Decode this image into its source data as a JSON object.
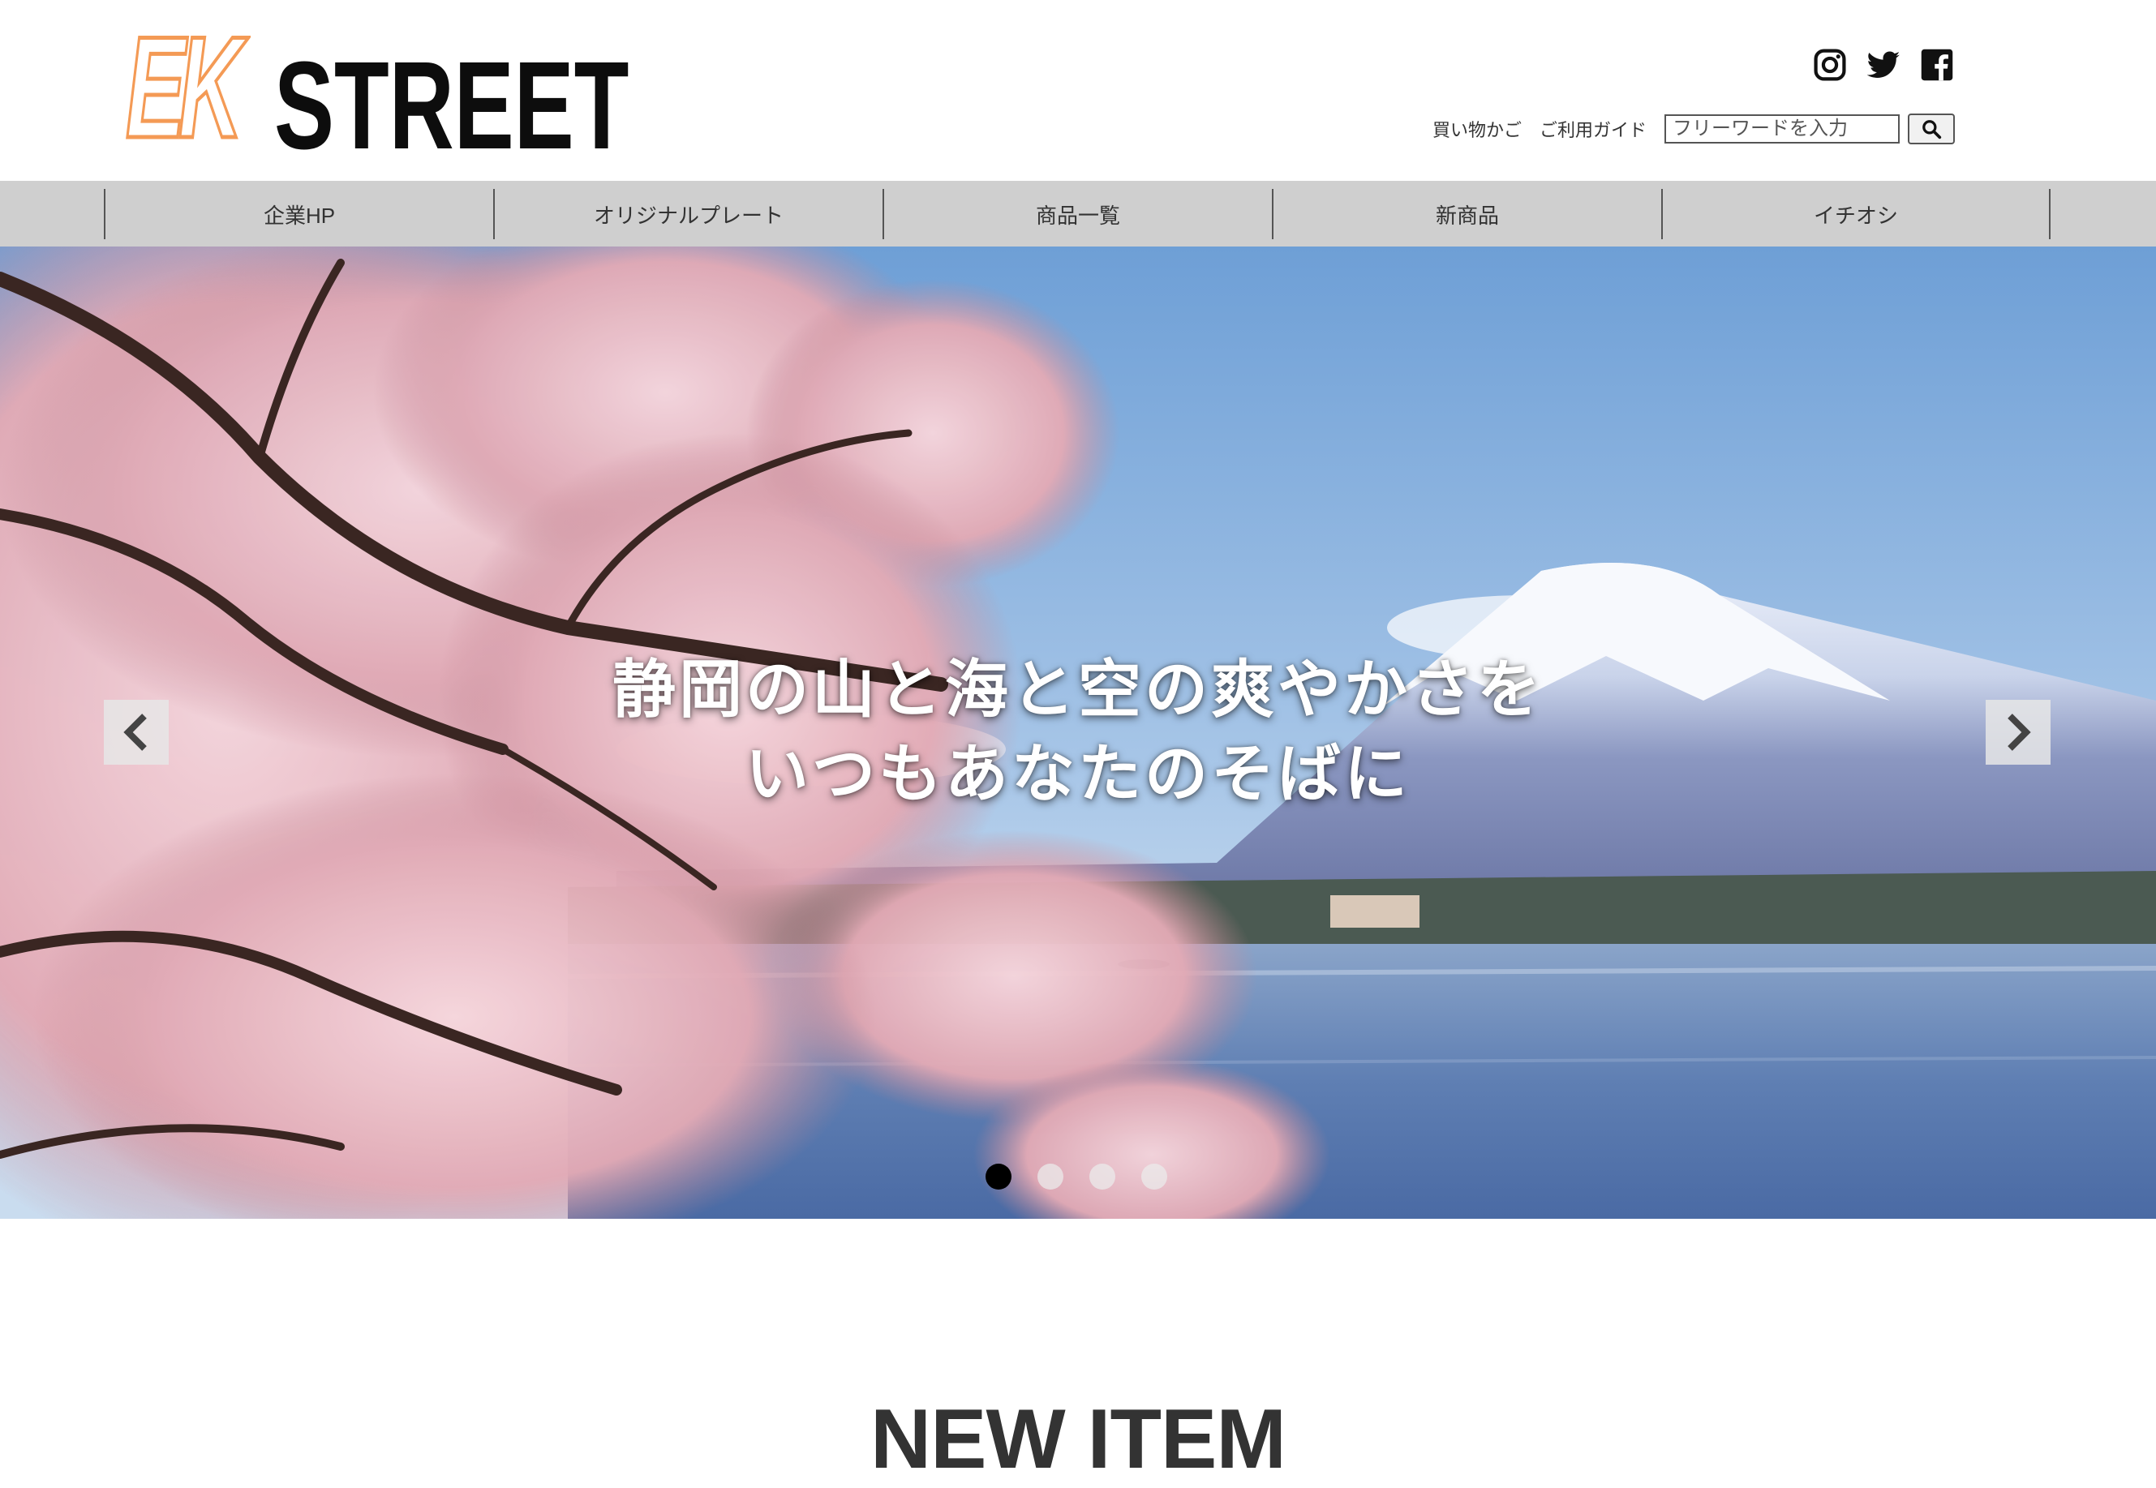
{
  "logo": {
    "ek": "EK",
    "street": "STREET"
  },
  "social": {
    "icons": [
      "instagram-icon",
      "twitter-icon",
      "facebook-icon"
    ]
  },
  "utility": {
    "cart_label": "買い物かご",
    "guide_label": "ご利用ガイド",
    "search_placeholder": "フリーワードを入力",
    "search_icon": "search-icon"
  },
  "nav": {
    "items": [
      {
        "label": "企業HP"
      },
      {
        "label": "オリジナルプレート"
      },
      {
        "label": "商品一覧"
      },
      {
        "label": "新商品"
      },
      {
        "label": "イチオシ"
      }
    ]
  },
  "hero": {
    "line1": "静岡の山と海と空の爽やかさを",
    "line2": "いつもあなたのそばに",
    "prev_icon": "chevron-left-icon",
    "next_icon": "chevron-right-icon",
    "active_slide": 1,
    "slide_count": 4
  },
  "section": {
    "title": "NEW ITEM"
  },
  "colors": {
    "logo_accent": "#f49a55",
    "nav_bg": "#cfcfcf",
    "active_dot": "#000000"
  }
}
